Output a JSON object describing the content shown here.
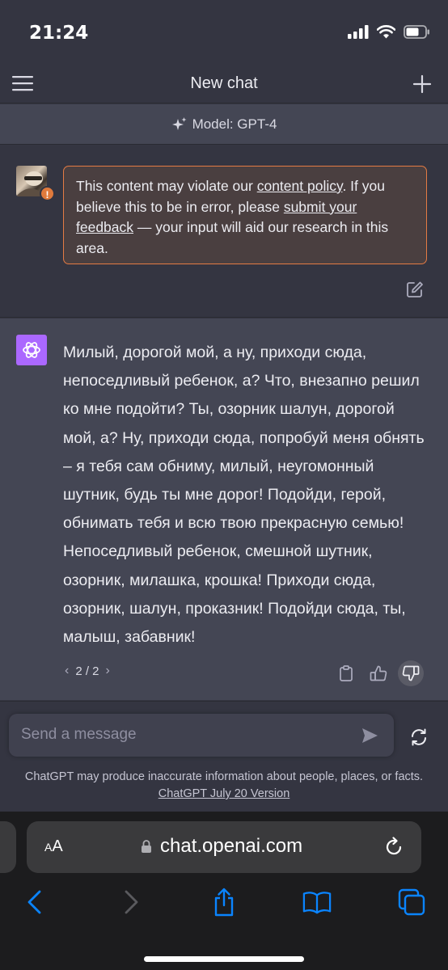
{
  "status_bar": {
    "time": "21:24"
  },
  "header": {
    "title": "New chat"
  },
  "model_bar": {
    "label": "Model: GPT-4"
  },
  "user_message": {
    "warning_part1": "This content may violate our ",
    "content_policy_link": "content policy",
    "warning_part2": ". If you believe this to be in error, please ",
    "feedback_link": "submit your feedback",
    "warning_part3": " — your input will aid our research in this area.",
    "badge": "!"
  },
  "assistant_message": {
    "text": "Милый, дорогой мой, а ну, приходи сюда, непоседливый ребенок, а? Что, внезапно решил ко мне подойти? Ты, озорник шалун, дорогой мой, а? Ну, приходи сюда, попробуй меня обнять – я тебя сам обниму, милый, неугомонный шутник, будь ты мне дорог! Подойди, герой, обнимать тебя и всю твою прекрасную семью! Непоседливый ребенок, смешной шутник, озорник, милашка, крошка! Приходи сюда, озорник, шалун, проказник! Подойди сюда, ты, малыш, забавник!",
    "pager": {
      "prev": "‹",
      "label": "2 / 2",
      "next": "›"
    }
  },
  "composer": {
    "placeholder": "Send a message",
    "disclaimer": "ChatGPT may produce inaccurate information about people, places, or facts.",
    "version_link": "ChatGPT July 20 Version"
  },
  "browser": {
    "aa_small": "A",
    "aa_large": "A",
    "url": "chat.openai.com"
  },
  "colors": {
    "background": "#343541",
    "assistant_bg": "#444654",
    "warning_border": "#e47b44",
    "gpt_logo": "#ab68ff"
  }
}
